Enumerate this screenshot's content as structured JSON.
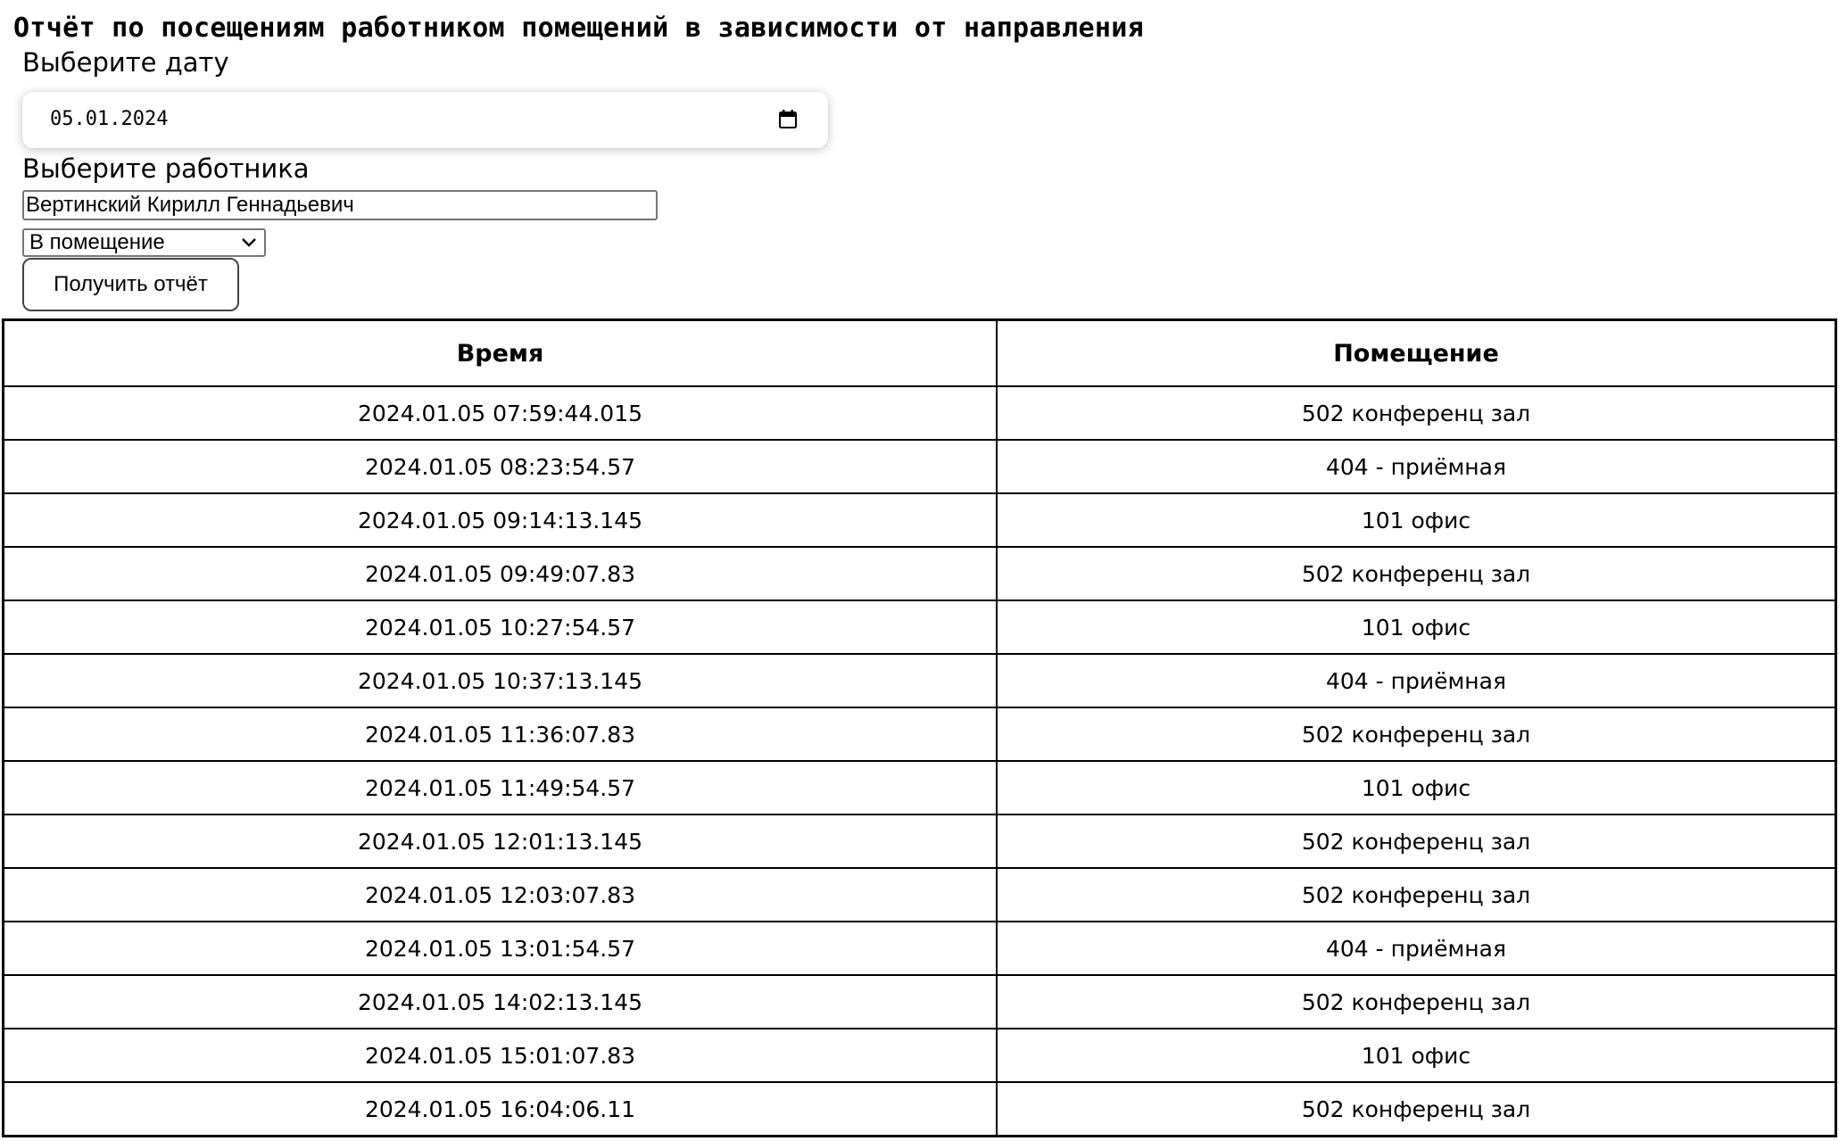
{
  "page": {
    "title": "Отчёт по посещениям работником помещений в зависимости от направления"
  },
  "form": {
    "date_label": "Выберите дату",
    "date_value": "05.01.2024",
    "worker_label": "Выберите работника",
    "worker_value": "Вертинский Кирилл Геннадьевич",
    "direction_selected": "В помещение",
    "submit_label": "Получить отчёт"
  },
  "icons": {
    "calendar": "calendar-icon",
    "dropdown": "chevron-down-icon"
  },
  "table": {
    "headers": [
      "Время",
      "Помещение"
    ],
    "rows": [
      {
        "time": "2024.01.05 07:59:44.015",
        "room": "502 конференц зал"
      },
      {
        "time": "2024.01.05 08:23:54.57",
        "room": "404 - приёмная"
      },
      {
        "time": "2024.01.05 09:14:13.145",
        "room": "101 офис"
      },
      {
        "time": "2024.01.05 09:49:07.83",
        "room": "502 конференц зал"
      },
      {
        "time": "2024.01.05 10:27:54.57",
        "room": "101 офис"
      },
      {
        "time": "2024.01.05 10:37:13.145",
        "room": "404 - приёмная"
      },
      {
        "time": "2024.01.05 11:36:07.83",
        "room": "502 конференц зал"
      },
      {
        "time": "2024.01.05 11:49:54.57",
        "room": "101 офис"
      },
      {
        "time": "2024.01.05 12:01:13.145",
        "room": "502 конференц зал"
      },
      {
        "time": "2024.01.05 12:03:07.83",
        "room": "502 конференц зал"
      },
      {
        "time": "2024.01.05 13:01:54.57",
        "room": "404 - приёмная"
      },
      {
        "time": "2024.01.05 14:02:13.145",
        "room": "502 конференц зал"
      },
      {
        "time": "2024.01.05 15:01:07.83",
        "room": "101 офис"
      },
      {
        "time": "2024.01.05 16:04:06.11",
        "room": "502 конференц зал"
      }
    ]
  }
}
